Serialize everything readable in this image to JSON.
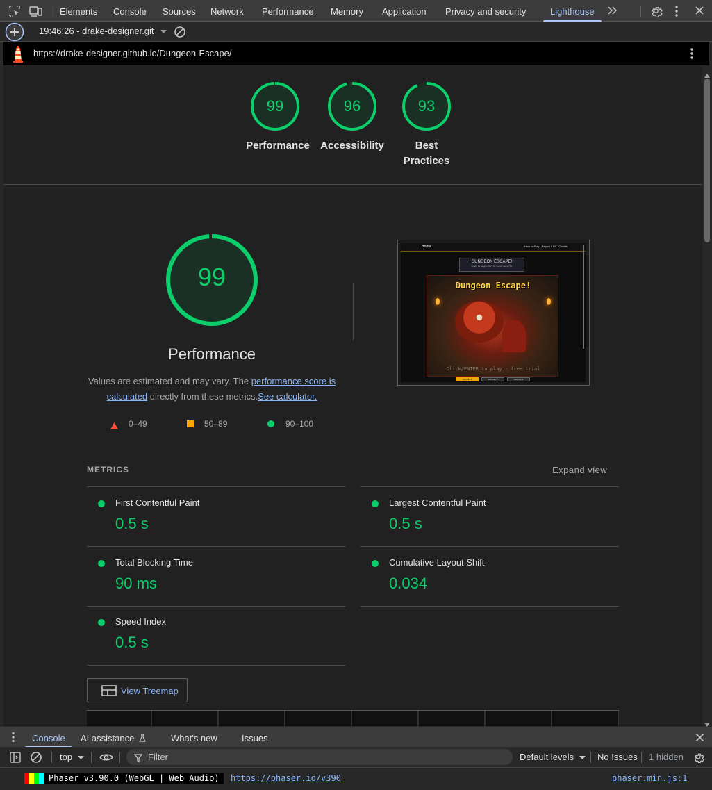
{
  "tabs": [
    {
      "label": "Elements"
    },
    {
      "label": "Console"
    },
    {
      "label": "Sources"
    },
    {
      "label": "Network"
    },
    {
      "label": "Performance"
    },
    {
      "label": "Memory"
    },
    {
      "label": "Application"
    },
    {
      "label": "Privacy and security"
    },
    {
      "label": "Lighthouse"
    }
  ],
  "subbar": {
    "report_select": "19:46:26 - drake-designer.git"
  },
  "urlbar": {
    "url": "https://drake-designer.github.io/Dungeon-Escape/"
  },
  "summary": {
    "gauges": [
      {
        "score": "99",
        "label": "Performance"
      },
      {
        "score": "96",
        "label": "Accessibility"
      },
      {
        "score": "93",
        "label_line1": "Best",
        "label_line2": "Practices"
      }
    ]
  },
  "performance": {
    "score": "99",
    "title": "Performance",
    "desc_prefix": "Values are estimated and may vary. The ",
    "desc_link": "performance score is calculated",
    "desc_link_a": "performance score is",
    "desc_link_b": "calculated",
    "desc_mid": " directly from these metrics.",
    "desc_calc_link": "See calculator.",
    "legend": {
      "fail": "0–49",
      "average": "50–89",
      "pass": "90–100"
    }
  },
  "screenshot": {
    "nav_left": "Home",
    "nav_right": "How to Play   Report A Bit   Credits",
    "banner_title": "DUNGEON ESCAPE!",
    "banner_sub": "Escape the dungeon before the monster catches you",
    "game_title": "Dungeon Escape!",
    "game_footer": "Click/ENTER to play - free trial",
    "buttons": [
      "Difficulty 1",
      "Difficulty 2",
      "Difficulty 3"
    ]
  },
  "metrics": {
    "header": "METRICS",
    "expand": "Expand view",
    "items": [
      {
        "title": "First Contentful Paint",
        "value": "0.5 s"
      },
      {
        "title": "Largest Contentful Paint",
        "value": "0.5 s"
      },
      {
        "title": "Total Blocking Time",
        "value": "90 ms"
      },
      {
        "title": "Cumulative Layout Shift",
        "value": "0.034"
      },
      {
        "title": "Speed Index",
        "value": "0.5 s"
      }
    ],
    "treemap": "View Treemap"
  },
  "drawer": {
    "tabs": [
      {
        "label": "Console"
      },
      {
        "label": "AI assistance"
      },
      {
        "label": "What's new"
      },
      {
        "label": "Issues"
      }
    ]
  },
  "console": {
    "context": "top",
    "filter_placeholder": "Filter",
    "levels": "Default levels",
    "issues": "No Issues",
    "hidden": "1 hidden",
    "message": "Phaser v3.90.0 (WebGL | Web Audio)",
    "message_link": "https://phaser.io/v390",
    "source": "phaser.min.js:1"
  },
  "colors": {
    "pass": "#0cce6b",
    "average": "#ffa400",
    "fail": "#ff4e42",
    "link": "#8ab4f8",
    "active_tab": "#a8c7fa"
  }
}
